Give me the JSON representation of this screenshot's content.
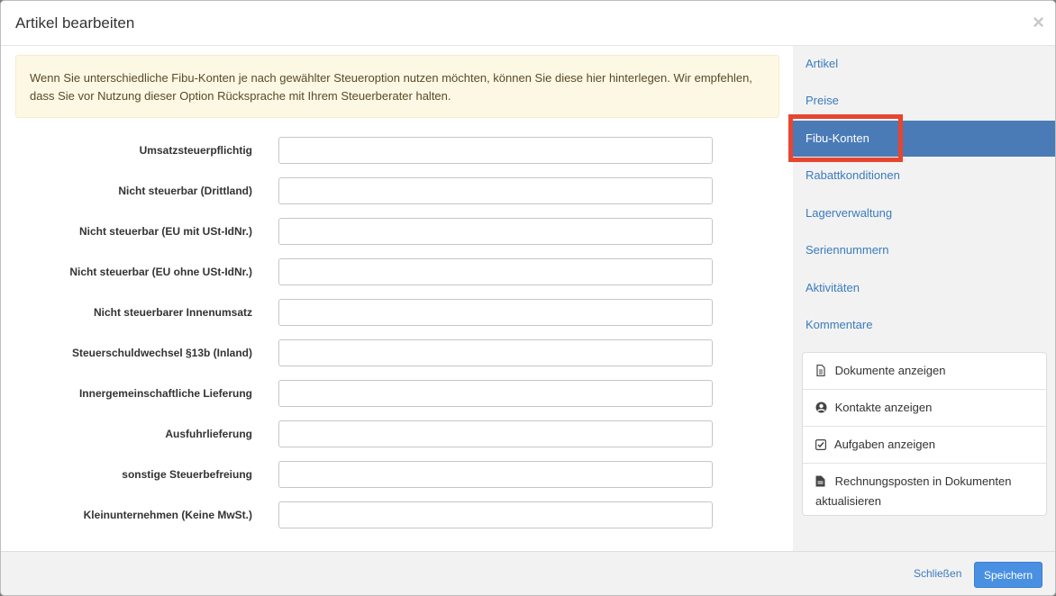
{
  "modal": {
    "title": "Artikel bearbeiten",
    "close_symbol": "×"
  },
  "alert": {
    "text": "Wenn Sie unterschiedliche Fibu-Konten je nach gewählter Steueroption nutzen möchten, können Sie diese hier hinterlegen. Wir empfehlen, dass Sie vor Nutzung dieser Option Rücksprache mit Ihrem Steuerberater halten."
  },
  "form": {
    "fields": [
      {
        "label": "Umsatzsteuerpflichtig",
        "value": ""
      },
      {
        "label": "Nicht steuerbar (Drittland)",
        "value": ""
      },
      {
        "label": "Nicht steuerbar (EU mit USt-IdNr.)",
        "value": ""
      },
      {
        "label": "Nicht steuerbar (EU ohne USt-IdNr.)",
        "value": ""
      },
      {
        "label": "Nicht steuerbarer Innenumsatz",
        "value": ""
      },
      {
        "label": "Steuerschuldwechsel §13b (Inland)",
        "value": ""
      },
      {
        "label": "Innergemeinschaftliche Lieferung",
        "value": ""
      },
      {
        "label": "Ausfuhrlieferung",
        "value": ""
      },
      {
        "label": "sonstige Steuerbefreiung",
        "value": ""
      },
      {
        "label": "Kleinunternehmen (Keine MwSt.)",
        "value": ""
      }
    ]
  },
  "sidebar": {
    "nav": [
      {
        "label": "Artikel"
      },
      {
        "label": "Preise"
      },
      {
        "label": "Fibu-Konten",
        "active": true
      },
      {
        "label": "Rabattkonditionen"
      },
      {
        "label": "Lagerverwaltung"
      },
      {
        "label": "Seriennummern"
      },
      {
        "label": "Aktivitäten"
      },
      {
        "label": "Kommentare"
      }
    ],
    "actions": [
      {
        "label": "Dokumente anzeigen",
        "icon": "document-icon"
      },
      {
        "label": "Kontakte anzeigen",
        "icon": "user-circle-icon"
      },
      {
        "label": "Aufgaben anzeigen",
        "icon": "checkbox-icon"
      },
      {
        "label": "Rechnungsposten in Dokumenten aktualisieren",
        "icon": "file-icon"
      }
    ]
  },
  "footer": {
    "close_label": "Schließen",
    "save_label": "Speichern"
  },
  "colors": {
    "accent": "#4a7bb7",
    "highlight": "#e8452f",
    "alert_bg": "#fcf8e3",
    "primary": "#4a90e2"
  }
}
